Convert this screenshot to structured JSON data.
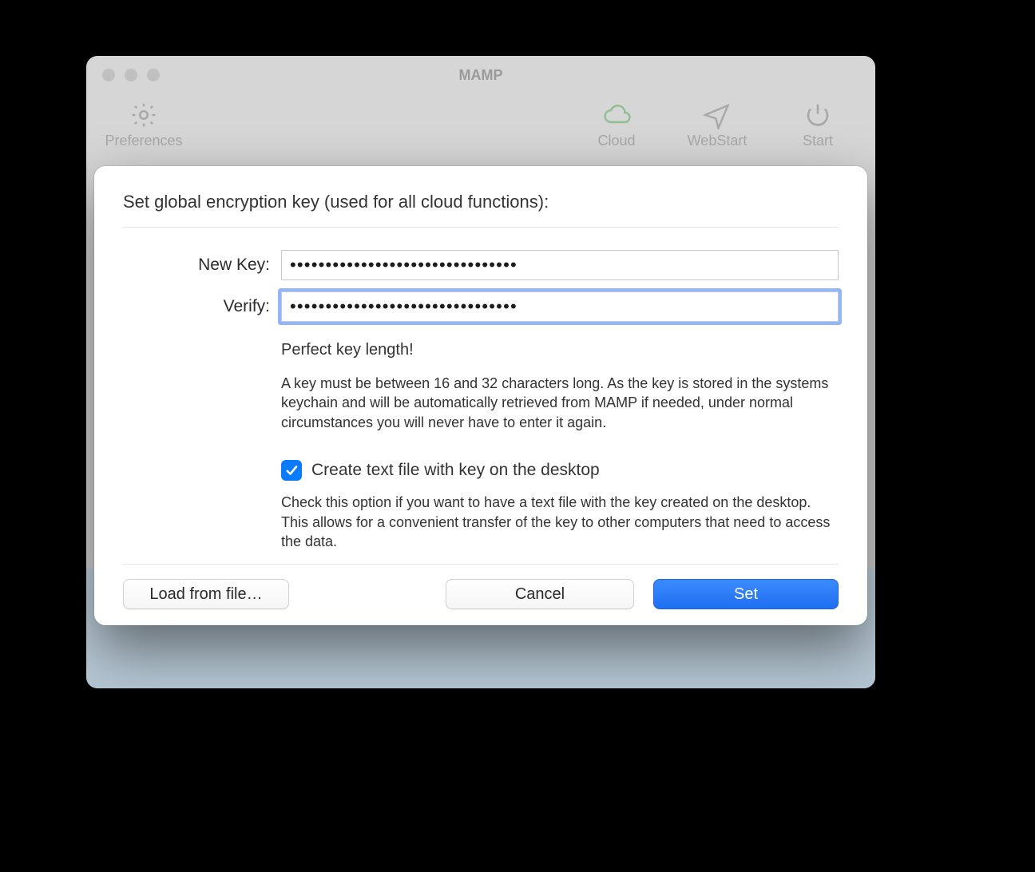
{
  "app_window": {
    "title": "MAMP",
    "toolbar": {
      "preferences_label": "Preferences",
      "cloud_label": "Cloud",
      "webstart_label": "WebStart",
      "start_label": "Start"
    }
  },
  "dialog": {
    "heading": "Set global encryption key (used for all cloud functions):",
    "labels": {
      "new_key": "New Key:",
      "verify": "Verify:"
    },
    "fields": {
      "new_key_value": "●●●●●●●●●●●●●●●●●●●●●●●●●●●●●●●●",
      "verify_value": "●●●●●●●●●●●●●●●●●●●●●●●●●●●●●●●●"
    },
    "status_text": "Perfect key length!",
    "help_text": "A key must be between 16 and 32 characters long. As the key is stored in the systems keychain and will be automatically retrieved from MAMP if needed, under normal circumstances you will never have to enter it again.",
    "checkbox": {
      "checked": true,
      "label": "Create text file with key on the desktop",
      "help": "Check this option if you want to have a text file with the key created on the desktop. This allows for a convenient transfer of the key to other computers that need to access the data."
    },
    "buttons": {
      "load_from_file": "Load from file…",
      "cancel": "Cancel",
      "set": "Set"
    }
  }
}
